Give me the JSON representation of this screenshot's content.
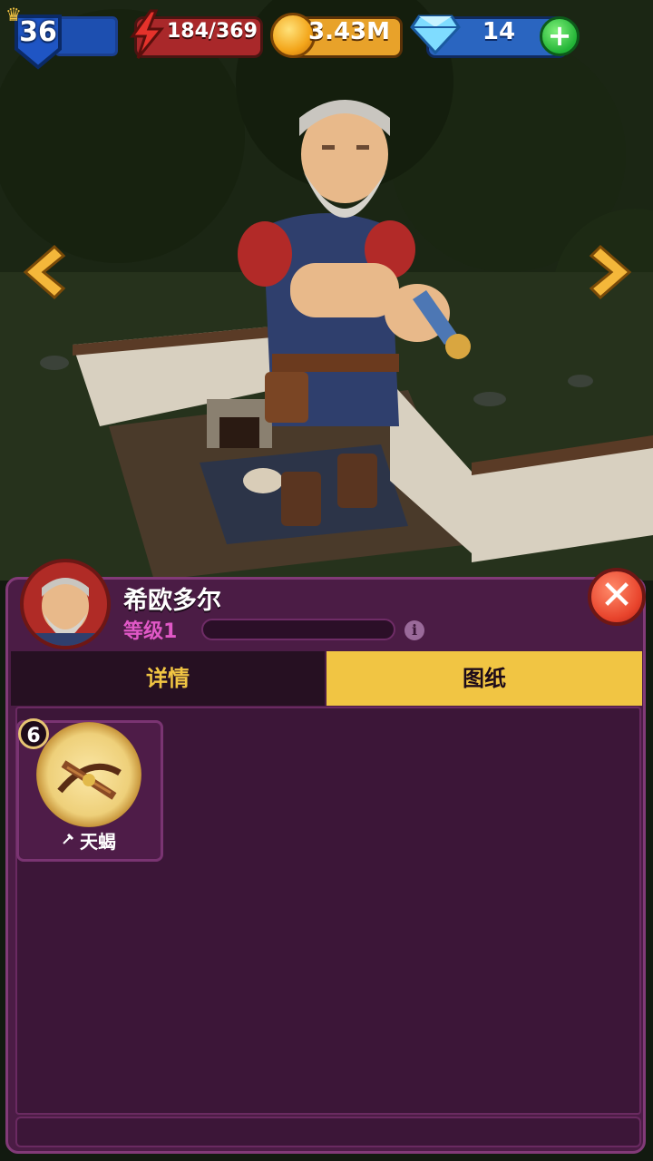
{
  "hud": {
    "player_level": "36",
    "energy": "184/369",
    "gold": "3.43M",
    "gems": "14",
    "add_label": "+"
  },
  "hero": {
    "name": "希欧多尔",
    "level_label": "等级1",
    "xp_progress": 0.0,
    "info_label": "i",
    "close_label": "✕"
  },
  "tabs": [
    {
      "label": "详情",
      "active": false
    },
    {
      "label": "图纸",
      "active": true
    }
  ],
  "blueprints": [
    {
      "name": "天蝎",
      "count": "6",
      "icon": "crossbow-icon"
    }
  ],
  "colors": {
    "panel": "#4b1c45",
    "tab_active": "#f1c543",
    "tab_inactive": "#261022",
    "level_text": "#e058c6"
  }
}
